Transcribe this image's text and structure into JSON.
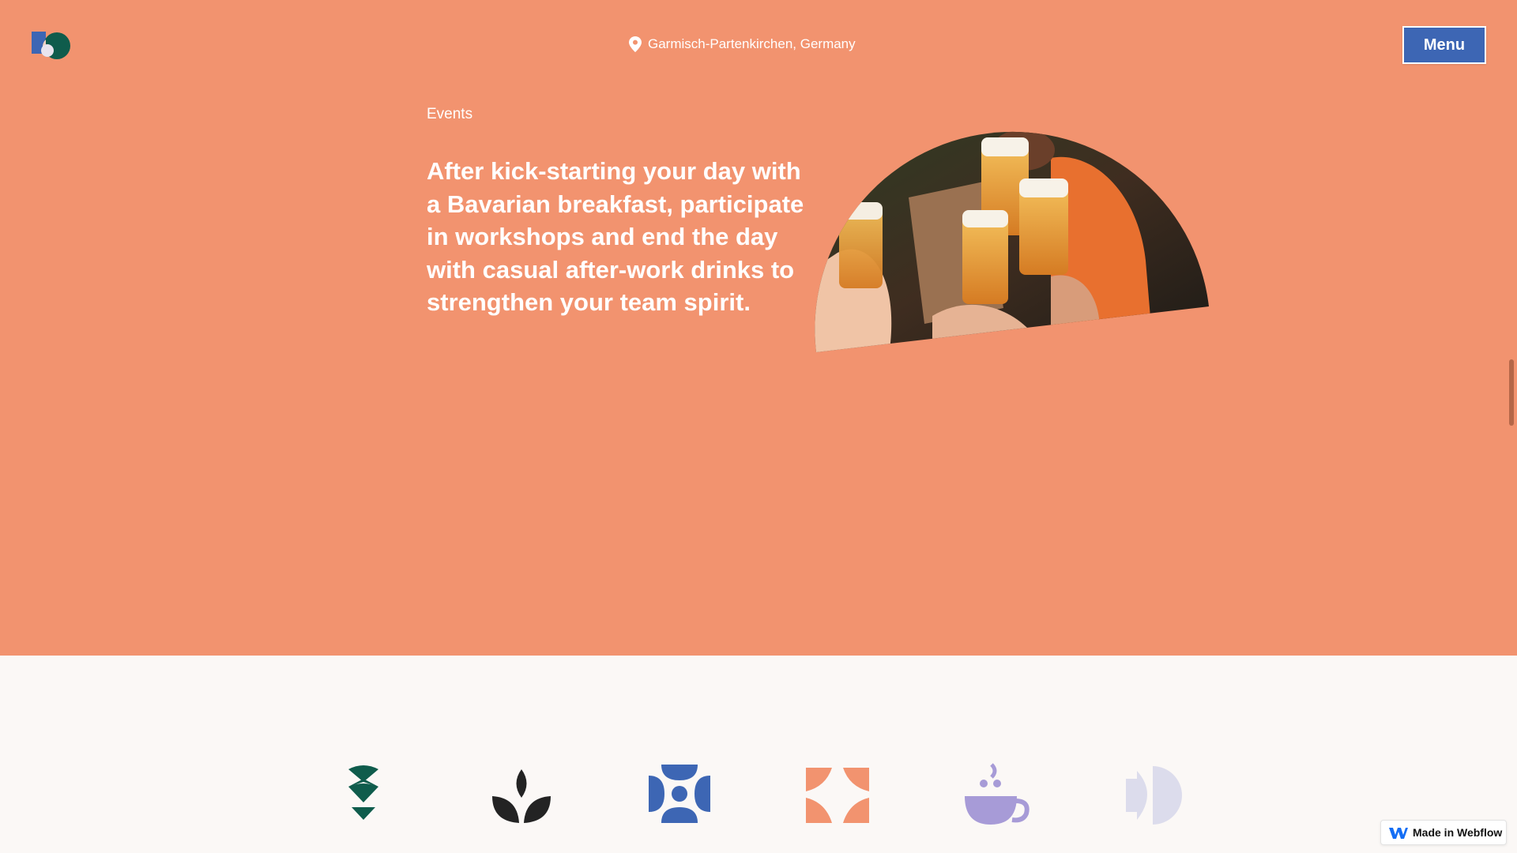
{
  "header": {
    "location": "Garmisch-Partenkirchen, Germany",
    "menu_label": "Menu"
  },
  "hero": {
    "eyebrow": "Events",
    "headline": "After kick-starting your day with a Bavarian breakfast, participate in workshops and end the day with casual after-work drinks to strengthen your team spirit."
  },
  "icons": [
    "stacked-diamonds-icon",
    "leaf-sprout-icon",
    "blue-cross-pattern-icon",
    "orange-quadrant-icon",
    "coffee-cup-icon",
    "lavender-half-circles-icon"
  ],
  "badge": {
    "label": "Made in Webflow"
  },
  "colors": {
    "hero_bg": "#f2936f",
    "page_bg": "#fbf8f6",
    "menu_button": "#3d66b4",
    "icon_green": "#0f5c4c",
    "icon_dark": "#232323",
    "icon_blue": "#3d66b4",
    "icon_orange": "#f2936f",
    "icon_purple": "#a79bd7",
    "icon_lavender": "#dcdcec"
  }
}
